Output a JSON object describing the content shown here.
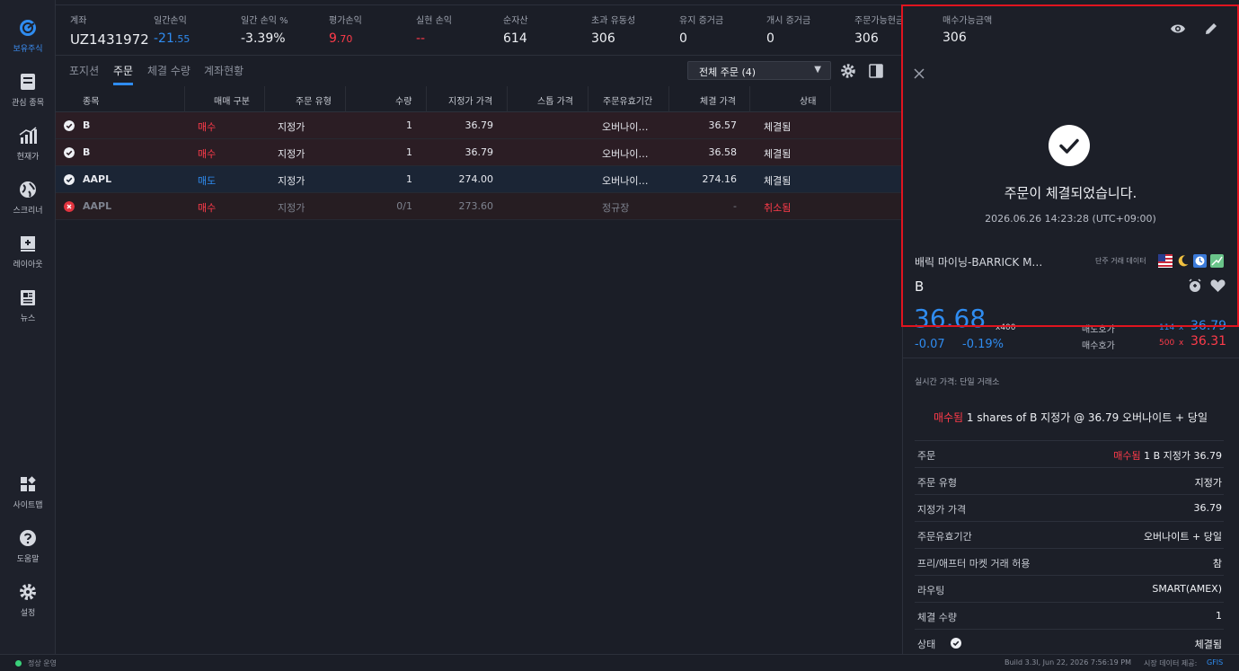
{
  "rail": {
    "items": [
      {
        "label": "보유주식",
        "icon": "holdings-icon"
      },
      {
        "label": "관심 종목",
        "icon": "watchlist-icon"
      },
      {
        "label": "현재가",
        "icon": "price-chart-icon"
      },
      {
        "label": "스크리너",
        "icon": "globe-icon"
      },
      {
        "label": "레이아웃",
        "icon": "layout-icon"
      },
      {
        "label": "뉴스",
        "icon": "news-icon"
      },
      {
        "label": "사이트맵",
        "icon": "sitemap-icon"
      },
      {
        "label": "도움말",
        "icon": "help-icon"
      },
      {
        "label": "설정",
        "icon": "settings-icon"
      }
    ]
  },
  "account": {
    "label": "계좌",
    "value": "UZ1431972",
    "stats": [
      {
        "label": "일간손익",
        "value": "-21",
        "dec": ".55"
      },
      {
        "label": "일간 손익 %",
        "value": "-3.39%",
        "dec": ""
      },
      {
        "label": "평가손익",
        "value": "9",
        "dec": ".70"
      },
      {
        "label": "실현 손익",
        "value": "--",
        "dec": ""
      },
      {
        "label": "순자산",
        "value": "614",
        "dec": ""
      },
      {
        "label": "초과 유동성",
        "value": "306",
        "dec": ""
      },
      {
        "label": "유지 증거금",
        "value": "0",
        "dec": ""
      },
      {
        "label": "개시 증거금",
        "value": "0",
        "dec": ""
      },
      {
        "label": "주문가능현금",
        "value": "306",
        "dec": ""
      },
      {
        "label": "매수가능금액",
        "value": "306",
        "dec": ""
      }
    ]
  },
  "tabs": [
    "포지션",
    "주문",
    "체결 수량",
    "계좌현황"
  ],
  "filter": {
    "label": "전체 주문 (4)",
    "caret": "▼"
  },
  "table": {
    "headers": [
      "종목",
      "매매 구분",
      "주문 유형",
      "수량",
      "지정가 가격",
      "스톱 가격",
      "주문유효기간",
      "체결 가격",
      "상태"
    ],
    "rows": [
      {
        "symbol": "B",
        "side": "매수",
        "type": "지정가",
        "qty": "1",
        "limit": "36.79",
        "stop": "",
        "tif": "오버나이…",
        "fill": "36.57",
        "status": "체결됨"
      },
      {
        "symbol": "B",
        "side": "매수",
        "type": "지정가",
        "qty": "1",
        "limit": "36.79",
        "stop": "",
        "tif": "오버나이…",
        "fill": "36.58",
        "status": "체결됨"
      },
      {
        "symbol": "AAPL",
        "side": "매도",
        "type": "지정가",
        "qty": "1",
        "limit": "274.00",
        "stop": "",
        "tif": "오버나이…",
        "fill": "274.16",
        "status": "체결됨"
      },
      {
        "symbol": "AAPL",
        "side": "매수",
        "type": "지정가",
        "qty": "0/1",
        "limit": "273.60",
        "stop": "",
        "tif": "정규장",
        "fill": "-",
        "status": "취소됨"
      }
    ]
  },
  "panel": {
    "confirm_title": "주문이 체결되었습니다.",
    "timestamp": "2026.06.26 14:23:28 (UTC+09:00)",
    "instrument_name": "배릭 마이닝-BARRICK M…",
    "data_note": "단주 거래 데이터",
    "symbol": "B",
    "last_price": "36.68",
    "multiplier": "x400",
    "change": "-0.07",
    "change_pct": "-0.19%",
    "ask_label": "매도호가",
    "ask_size": "114",
    "ask_x": "x",
    "ask_price": "36.79",
    "bid_label": "매수호가",
    "bid_size": "500",
    "bid_x": "x",
    "bid_price": "36.31",
    "realtime_note": "실시간 가격: 단일 거래소",
    "summary_prefix": "매수됨",
    "summary_rest": "1 shares of B 지정가 @ 36.79 오버나이트 + 당일",
    "details": [
      {
        "label": "주문",
        "value": "1 B 지정가 36.79",
        "prefix": "매수됨"
      },
      {
        "label": "주문 유형",
        "value": "지정가",
        "prefix": ""
      },
      {
        "label": "지정가 가격",
        "value": "36.79",
        "prefix": ""
      },
      {
        "label": "주문유효기간",
        "value": "오버나이트 + 당일",
        "prefix": ""
      },
      {
        "label": "프리/애프터 마켓 거래 허용",
        "value": "참",
        "prefix": ""
      },
      {
        "label": "라우팅",
        "value": "SMART(AMEX)",
        "prefix": ""
      },
      {
        "label": "체결 수량",
        "value": "1",
        "prefix": ""
      },
      {
        "label": "상태",
        "value": "체결됨",
        "prefix": ""
      }
    ]
  },
  "footer": {
    "status": "정상 운영",
    "build": "Build 3.3l, Jun 22, 2026 7:56:19 PM",
    "data_label": "시장 데이터 제공:",
    "data_source": "GFIS"
  },
  "colors": {
    "accent": "#2f8cf0",
    "buy": "#ff3b4a",
    "sell": "#2f8cf0",
    "highlight": "#e0141f"
  }
}
